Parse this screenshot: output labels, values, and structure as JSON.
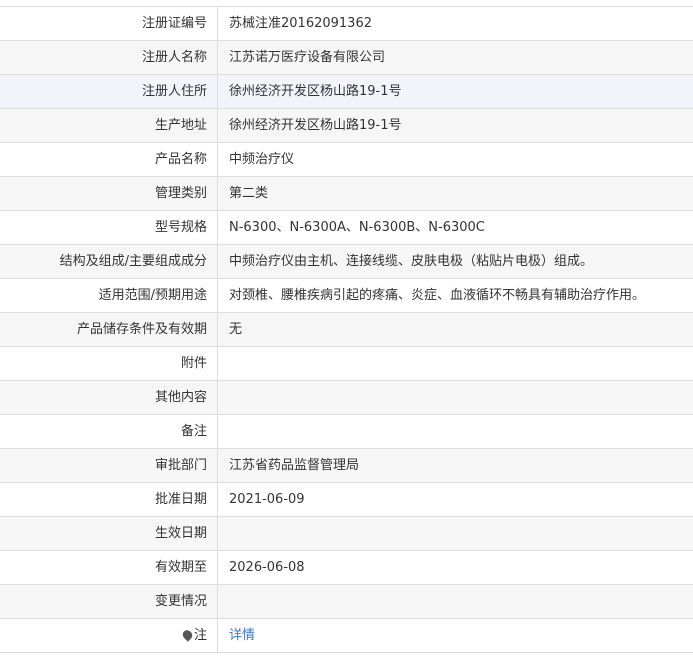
{
  "rows": [
    {
      "label": "注册证编号",
      "value": "苏械注准20162091362"
    },
    {
      "label": "注册人名称",
      "value": "江苏诺万医疗设备有限公司"
    },
    {
      "label": "注册人住所",
      "value": "徐州经济开发区杨山路19-1号"
    },
    {
      "label": "生产地址",
      "value": "徐州经济开发区杨山路19-1号"
    },
    {
      "label": "产品名称",
      "value": "中频治疗仪"
    },
    {
      "label": "管理类别",
      "value": "第二类"
    },
    {
      "label": "型号规格",
      "value": "N-6300、N-6300A、N-6300B、N-6300C"
    },
    {
      "label": "结构及组成/主要组成成分",
      "value": "中频治疗仪由主机、连接线缆、皮肤电极（粘贴片电极）组成。"
    },
    {
      "label": "适用范围/预期用途",
      "value": "对颈椎、腰椎疾病引起的疼痛、炎症、血液循环不畅具有辅助治疗作用。"
    },
    {
      "label": "产品储存条件及有效期",
      "value": "无"
    },
    {
      "label": "附件",
      "value": ""
    },
    {
      "label": "其他内容",
      "value": ""
    },
    {
      "label": "备注",
      "value": ""
    },
    {
      "label": "审批部门",
      "value": "江苏省药品监督管理局"
    },
    {
      "label": "批准日期",
      "value": "2021-06-09"
    },
    {
      "label": "生效日期",
      "value": ""
    },
    {
      "label": "有效期至",
      "value": "2026-06-08"
    },
    {
      "label": "变更情况",
      "value": ""
    }
  ],
  "note": {
    "icon": "pin-icon",
    "label": "注",
    "link_text": "详情"
  }
}
